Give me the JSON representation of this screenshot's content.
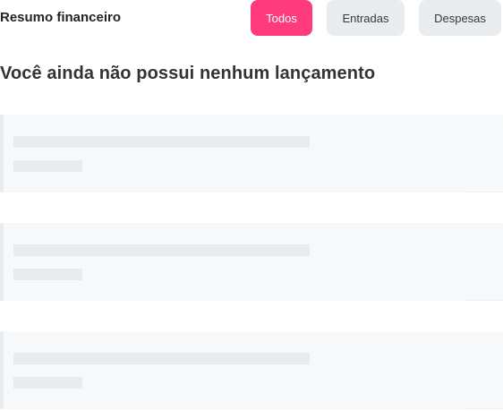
{
  "header": {
    "title": "Resumo financeiro",
    "filters": [
      {
        "label": "Todos",
        "active": true
      },
      {
        "label": "Entradas",
        "active": false
      },
      {
        "label": "Despesas",
        "active": false
      }
    ]
  },
  "main": {
    "empty_message": "Você ainda não possui nenhum lançamento",
    "placeholder_cards": 3
  },
  "colors": {
    "accent": "#ff3a7d",
    "button_inactive": "#e9ecef",
    "card_background": "#f7f8fa",
    "skeleton_line": "#e9eaec"
  }
}
